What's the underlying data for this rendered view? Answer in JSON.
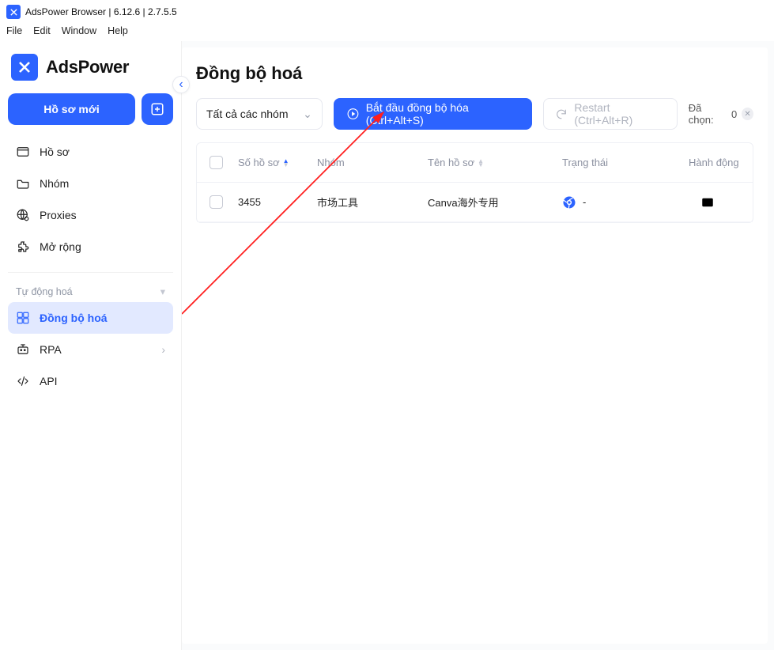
{
  "window": {
    "title": "AdsPower Browser | 6.12.6 | 2.7.5.5"
  },
  "menubar": {
    "file": "File",
    "edit": "Edit",
    "window": "Window",
    "help": "Help"
  },
  "brand": {
    "name": "AdsPower"
  },
  "sidebar": {
    "new_profile": "Hồ sơ mới",
    "items": [
      {
        "label": "Hồ sơ"
      },
      {
        "label": "Nhóm"
      },
      {
        "label": "Proxies"
      },
      {
        "label": "Mở rộng"
      }
    ],
    "automation_label": "Tự động hoá",
    "automation": [
      {
        "label": "Đồng bộ hoá"
      },
      {
        "label": "RPA"
      },
      {
        "label": "API"
      }
    ]
  },
  "page": {
    "title": "Đồng bộ hoá",
    "group_select": "Tất cả các nhóm",
    "start_sync": "Bắt đầu đồng bộ hóa (Ctrl+Alt+S)",
    "restart": "Restart (Ctrl+Alt+R)",
    "selected_label": "Đã chọn:",
    "selected_count": "0"
  },
  "table": {
    "headers": {
      "profile_no": "Số hồ sơ",
      "group": "Nhóm",
      "profile_name": "Tên hồ sơ",
      "status": "Trạng thái",
      "action": "Hành động"
    },
    "rows": [
      {
        "profile_no": "3455",
        "group": "市场工具",
        "profile_name": "Canva海外专用",
        "status": "-"
      }
    ]
  }
}
